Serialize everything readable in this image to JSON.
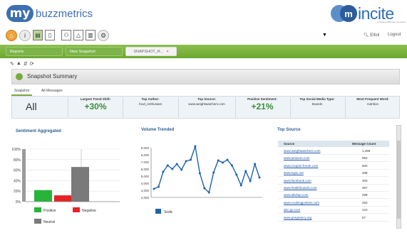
{
  "header": {
    "logo_badge": "my",
    "brand": "buzzmetrics",
    "right_logo": "incite",
    "right_logo_tag": "A Nielsen McKinsey Company"
  },
  "toolbar": {
    "icons": [
      "home-icon",
      "info-icon",
      "save-icon",
      "document-icon",
      "people-icon",
      "alert-icon",
      "book-icon",
      "settings-icon"
    ],
    "dropdown_value": "",
    "search_label": "Elfoil",
    "logout_label": "Logout"
  },
  "tabs": [
    {
      "label": "Reports"
    },
    {
      "label": "New Snapshot"
    },
    {
      "label": "SNAPSHOT_R..."
    }
  ],
  "summary": {
    "title": "Snapshot Summary",
    "subtabs": [
      "Snapshot",
      "All Messages"
    ],
    "kpis": {
      "all": "All",
      "trend_shift_label": "Largest Trend Shift:",
      "trend_shift_value": "+30%",
      "top_author_label": "Top Author:",
      "top_author_value": "food_enthusiast",
      "top_source_label": "Top Source:",
      "top_source_value": "www.weightwatchers.com",
      "positive_label": "Positive Sentiment:",
      "positive_value": "+21%",
      "media_type_label": "Top Social Media Type:",
      "media_type_value": "Boards",
      "frequent_word_label": "Most Frequent Word:",
      "frequent_word_value": "nutrition"
    }
  },
  "colors": {
    "positive": "#27b43b",
    "negative": "#e62225",
    "neutral": "#7a7a7a",
    "line": "#1f63a8",
    "accent_green": "#79ab3c"
  },
  "panels": {
    "sentiment_title": "Sentiment Aggregated",
    "volume_title": "Volume Trended",
    "top_source_title": "Top Source"
  },
  "chart_data": [
    {
      "type": "bar",
      "title": "Sentiment Aggregated",
      "categories": [
        "Positive",
        "Negative",
        "Neutral"
      ],
      "values": [
        22,
        12,
        66
      ],
      "ylim": [
        0,
        100
      ],
      "yticks": [
        "0%",
        "20%",
        "40%",
        "60%",
        "80%",
        "100%"
      ],
      "legend": [
        "Positive",
        "Negative",
        "Neutral"
      ]
    },
    {
      "type": "line",
      "title": "Volume Trended",
      "series": [
        {
          "name": "Soda",
          "values": [
            3200,
            3500,
            5600,
            6500,
            6000,
            6700,
            5900,
            7100,
            7300,
            9200,
            5400,
            3300,
            2700,
            5500,
            7200,
            6900,
            7300,
            6500,
            5200,
            3700,
            5700,
            4300,
            6700,
            4800
          ]
        }
      ],
      "ylim": [
        2000,
        9000
      ],
      "yticks": [
        "2,000",
        "3,000",
        "4,000",
        "5,000",
        "6,000",
        "7,000",
        "8,000",
        "9,000"
      ]
    },
    {
      "type": "table",
      "title": "Top Source",
      "columns": [
        "Source",
        "Message Count"
      ],
      "rows": [
        [
          "www.weightwatchers.com",
          "1,459"
        ],
        [
          "www.amazon.com",
          "962"
        ],
        [
          "www.coupon-forum.com",
          "500"
        ],
        [
          "www.topix.net",
          "488"
        ],
        [
          "www.facebook.com",
          "403"
        ],
        [
          "www.healthboards.com",
          "367"
        ],
        [
          "www.allvitup.com",
          "298"
        ],
        [
          "www.cookingjunkies.com",
          "250"
        ],
        [
          "abc.go.com",
          "123"
        ],
        [
          "www.pregnancy.org",
          "97"
        ]
      ]
    }
  ]
}
